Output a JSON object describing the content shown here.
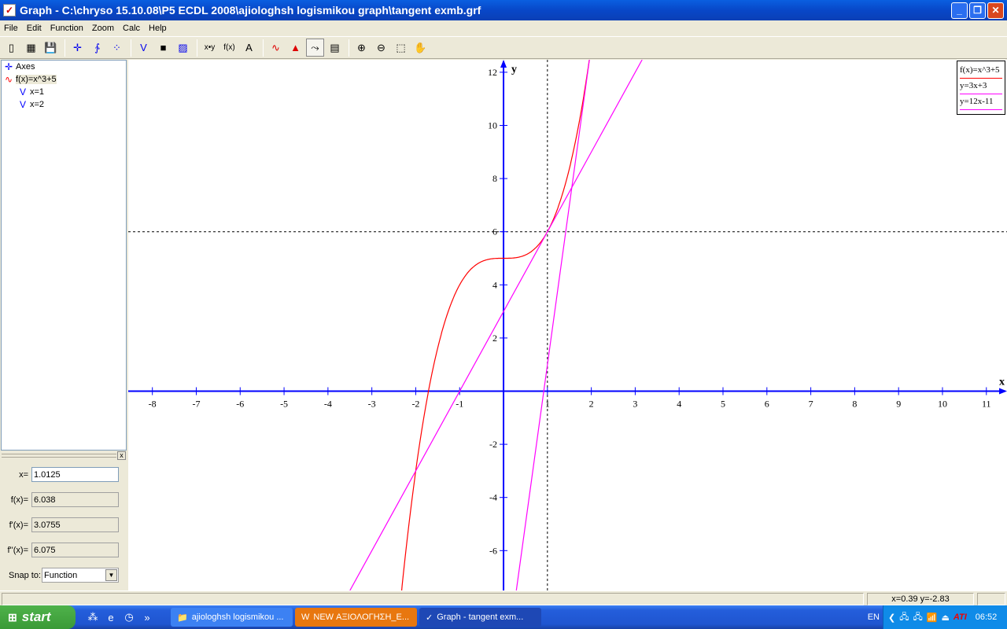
{
  "window": {
    "title": "Graph - C:\\chryso 15.10.08\\P5 ECDL 2008\\ajiologhsh logismikou graph\\tangent exmb.grf"
  },
  "menu": [
    "File",
    "Edit",
    "Function",
    "Zoom",
    "Calc",
    "Help"
  ],
  "toolbar": [
    {
      "name": "new-icon",
      "glyph": "▯"
    },
    {
      "name": "open-icon",
      "glyph": "▦"
    },
    {
      "name": "save-icon",
      "glyph": "💾"
    },
    "sep",
    {
      "name": "axes-icon",
      "glyph": "✛"
    },
    {
      "name": "insert-function-icon",
      "glyph": "∱"
    },
    {
      "name": "point-series-icon",
      "glyph": "⁘"
    },
    "sep",
    {
      "name": "tangent-icon",
      "glyph": "V"
    },
    {
      "name": "shading-icon",
      "glyph": "■"
    },
    {
      "name": "relation-icon",
      "glyph": "▨"
    },
    "sep",
    {
      "name": "text-xy-icon",
      "glyph": "x•y"
    },
    {
      "name": "fx-icon",
      "glyph": "f(x)"
    },
    {
      "name": "label-icon",
      "glyph": "A"
    },
    "sep",
    {
      "name": "trendline-icon",
      "glyph": "∿"
    },
    {
      "name": "area-icon",
      "glyph": "▲"
    },
    {
      "name": "evaluate-icon",
      "glyph": "⤳",
      "active": true
    },
    {
      "name": "table-icon",
      "glyph": "▤"
    },
    "sep",
    {
      "name": "zoom-in-icon",
      "glyph": "⊕"
    },
    {
      "name": "zoom-out-icon",
      "glyph": "⊖"
    },
    {
      "name": "zoom-window-icon",
      "glyph": "⬚"
    },
    {
      "name": "pan-hand-icon",
      "glyph": "✋"
    }
  ],
  "tree": [
    {
      "label": "Axes",
      "icon": "axes-icon",
      "glyph": "✛",
      "color": "#0000ff",
      "indent": 0
    },
    {
      "label": "f(x)=x^3+5",
      "icon": "function-icon",
      "glyph": "∿",
      "color": "#ff0000",
      "indent": 0,
      "selected": true
    },
    {
      "label": "x=1",
      "icon": "tangent-icon",
      "glyph": "V",
      "color": "#0000ff",
      "indent": 1
    },
    {
      "label": "x=2",
      "icon": "tangent-icon",
      "glyph": "V",
      "color": "#0000ff",
      "indent": 1
    }
  ],
  "eval": {
    "x_label": "x=",
    "x_value": "1.0125",
    "fx_label": "f(x)=",
    "fx_value": "6.038",
    "f1_label": "f'(x)=",
    "f1_value": "3.0755",
    "f2_label": "f''(x)=",
    "f2_value": "6.075",
    "snap_label": "Snap to:",
    "snap_value": "Function"
  },
  "legend": [
    {
      "text": "f(x)=x^3+5",
      "color": "#ff0000"
    },
    {
      "text": "y=3x+3",
      "color": "#ff00ff"
    },
    {
      "text": "y=12x-11",
      "color": "#ff00ff"
    }
  ],
  "status": {
    "coords": "x=0.39  y=-2.83"
  },
  "taskbar": {
    "start": "start",
    "tasks": [
      "ajiologhsh logismikou ...",
      "NEW ΑΞΙΟΛΟΓΗΣΗ_Ε...",
      "Graph - tangent exm..."
    ],
    "lang": "EN",
    "clock": "06:52"
  },
  "chart_data": {
    "type": "line",
    "xlim": [
      -8.55,
      11.47
    ],
    "ylim": [
      -7.5,
      12.47
    ],
    "xlabel": "x",
    "ylabel": "y",
    "xticks": [
      -8,
      -7,
      -6,
      -5,
      -4,
      -3,
      -2,
      -1,
      1,
      2,
      3,
      4,
      5,
      6,
      7,
      8,
      9,
      10,
      11
    ],
    "yticks": [
      -6,
      -4,
      -2,
      2,
      4,
      6,
      8,
      10,
      12
    ],
    "axis_color": "#0000ff",
    "series": [
      {
        "name": "f(x)=x^3+5",
        "expr": "x^3+5",
        "color": "#ff0000"
      },
      {
        "name": "y=3x+3",
        "slope": 3,
        "intercept": 3,
        "color": "#ff00ff"
      },
      {
        "name": "y=12x-11",
        "slope": 12,
        "intercept": -11,
        "color": "#ff00ff"
      }
    ],
    "crosshair": {
      "x": 1,
      "y": 6
    }
  }
}
